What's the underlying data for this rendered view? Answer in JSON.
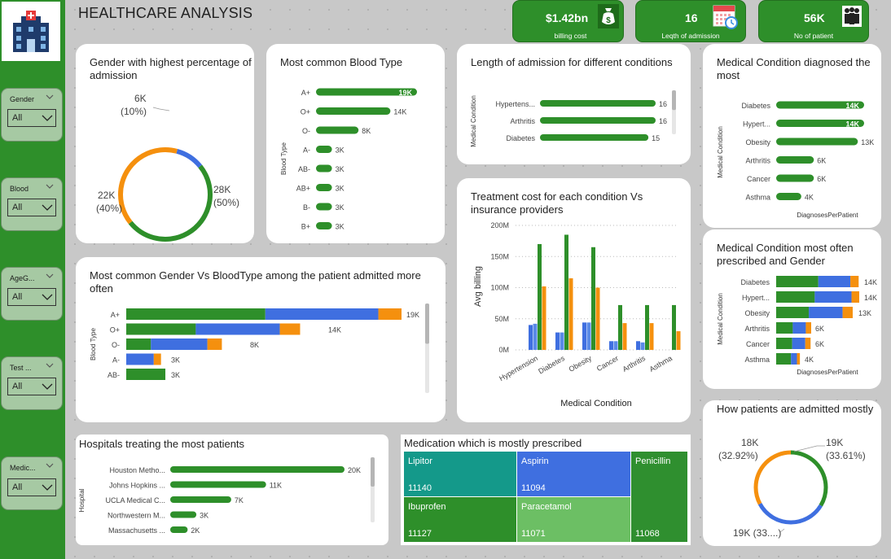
{
  "title": "HEALTHCARE ANALYSIS",
  "colors": {
    "green": "#2e8f2a",
    "blue": "#3f6fe0",
    "orange": "#f5900e",
    "light_green": "#6cbf64",
    "teal": "#1a9a88",
    "dark_green": "#2f8f2f"
  },
  "kpis": [
    {
      "value": "$1.42bn",
      "caption": "billing cost",
      "icon": "money-bag-icon"
    },
    {
      "value": "16",
      "caption": "Leqth of admission",
      "icon": "calendar-icon"
    },
    {
      "value": "56K",
      "caption": "No of patient",
      "icon": "people-icon"
    }
  ],
  "slicers": [
    {
      "label": "Gender",
      "value": "All"
    },
    {
      "label": "Blood",
      "value": "All"
    },
    {
      "label": "AgeG...",
      "value": "All"
    },
    {
      "label": "Test ...",
      "value": "All"
    },
    {
      "label": "Medic...",
      "value": "All"
    }
  ],
  "cards": {
    "gender": {
      "title": "Gender with highest percentage of admission"
    },
    "blood": {
      "title": "Most common Blood Type"
    },
    "length": {
      "title": "Length of admission for different conditions"
    },
    "diag": {
      "title": "Medical Condition diagnosed the most"
    },
    "gender_blood": {
      "title": "Most common Gender Vs BloodType among the patient admitted more often"
    },
    "treatment": {
      "title": "Treatment cost for each condition Vs insurance providers"
    },
    "presc": {
      "title": "Medical Condition most often prescribed and Gender"
    },
    "hospitals": {
      "title": "Hospitals treating the most patients"
    },
    "medication": {
      "title": "Medication which is mostly prescribed"
    },
    "admitted": {
      "title": "How patients are admitted mostly"
    }
  },
  "chart_data": [
    {
      "id": "gender_donut",
      "type": "pie",
      "slices": [
        {
          "label_top": "6K",
          "label_bottom": "(10%)",
          "value": 10,
          "color": "#3f6fe0"
        },
        {
          "label_top": "28K",
          "label_bottom": "(50%)",
          "value": 50,
          "color": "#2e8f2a"
        },
        {
          "label_top": "22K",
          "label_bottom": "(40%)",
          "value": 40,
          "color": "#f5900e"
        }
      ]
    },
    {
      "id": "blood_bar",
      "type": "bar",
      "ylabel": "Blood Type",
      "categories": [
        "A+",
        "O+",
        "O-",
        "A-",
        "AB-",
        "AB+",
        "B-",
        "B+"
      ],
      "values": [
        19,
        14,
        8,
        3,
        3,
        3,
        3,
        3
      ],
      "labels": [
        "19K",
        "14K",
        "8K",
        "3K",
        "3K",
        "3K",
        "3K",
        "3K"
      ]
    },
    {
      "id": "length_bar",
      "type": "bar",
      "ylabel": "Medical Condition",
      "categories": [
        "Hypertens...",
        "Arthritis",
        "Diabetes"
      ],
      "values": [
        16,
        16,
        15
      ],
      "labels": [
        "16",
        "16",
        "15"
      ]
    },
    {
      "id": "diag_bar",
      "type": "bar",
      "ylabel": "Medical Condition",
      "xlabel": "DiagnosesPerPatient",
      "categories": [
        "Diabetes",
        "Hypert...",
        "Obesity",
        "Arthritis",
        "Cancer",
        "Asthma"
      ],
      "values": [
        14,
        14,
        13,
        6,
        6,
        4
      ],
      "labels": [
        "14K",
        "14K",
        "13K",
        "6K",
        "6K",
        "4K"
      ]
    },
    {
      "id": "gender_blood_bar",
      "type": "bar",
      "ylabel": "Blood Type",
      "categories": [
        "A+",
        "O+",
        "O-",
        "A-",
        "AB-"
      ],
      "series": [
        {
          "values": [
            9.6,
            4.8,
            1.7,
            0,
            2.7
          ],
          "color": "#2e8f2a"
        },
        {
          "values": [
            7.8,
            5.8,
            3.9,
            1.9,
            0
          ],
          "color": "#3f6fe0"
        },
        {
          "values": [
            1.6,
            1.4,
            1.0,
            0.5,
            0
          ],
          "color": "#f5900e"
        }
      ],
      "labels": [
        "19K",
        "14K",
        "8K",
        "3K",
        "3K"
      ]
    },
    {
      "id": "treatment_bar",
      "type": "bar",
      "ylabel": "Avg billing",
      "xlabel": "Medical Condition",
      "ylim": [
        0,
        200
      ],
      "yticks": [
        "0M",
        "50M",
        "100M",
        "150M",
        "200M"
      ],
      "categories": [
        "Hypertension",
        "Diabetes",
        "Obesity",
        "Cancer",
        "Arthritis",
        "Asthma"
      ],
      "series": [
        {
          "values": [
            40,
            28,
            44,
            14,
            14,
            0
          ],
          "color": "#3f6fe0"
        },
        {
          "values": [
            42,
            28,
            44,
            14,
            12,
            0
          ],
          "color": "#5a8ae8"
        },
        {
          "values": [
            170,
            185,
            165,
            72,
            72,
            72
          ],
          "color": "#2e8f2a"
        },
        {
          "values": [
            102,
            115,
            100,
            43,
            43,
            30
          ],
          "color": "#f5900e"
        }
      ]
    },
    {
      "id": "presc_bar",
      "type": "bar",
      "ylabel": "Medical Condition",
      "xlabel": "DiagnosesPerPatient",
      "categories": [
        "Diabetes",
        "Hypert...",
        "Obesity",
        "Arthritis",
        "Cancer",
        "Asthma"
      ],
      "series": [
        {
          "values": [
            7.1,
            6.5,
            5.5,
            2.8,
            2.7,
            2.5
          ],
          "color": "#2e8f2a"
        },
        {
          "values": [
            5.4,
            6.2,
            5.7,
            2.2,
            2.2,
            1.0
          ],
          "color": "#3f6fe0"
        },
        {
          "values": [
            1.4,
            1.3,
            1.7,
            0.9,
            0.9,
            0.5
          ],
          "color": "#f5900e"
        }
      ],
      "labels": [
        "14K",
        "14K",
        "13K",
        "6K",
        "6K",
        "4K"
      ]
    },
    {
      "id": "hospital_bar",
      "type": "bar",
      "ylabel": "Hospital",
      "categories": [
        "Houston Metho...",
        "Johns Hopkins ...",
        "UCLA Medical C...",
        "Northwestern M...",
        "Massachusetts ..."
      ],
      "values": [
        20,
        11,
        7,
        3,
        2
      ],
      "labels": [
        "20K",
        "11K",
        "7K",
        "3K",
        "2K"
      ]
    },
    {
      "id": "medication_treemap",
      "type": "table",
      "items": [
        {
          "name": "Lipitor",
          "value": "11140",
          "color": "#14998a"
        },
        {
          "name": "Aspirin",
          "value": "11094",
          "color": "#3f6fe0"
        },
        {
          "name": "Penicillin",
          "value": "11068",
          "color": "#2f8f2f"
        },
        {
          "name": "Ibuprofen",
          "value": "11127",
          "color": "#2e8f2a"
        },
        {
          "name": "Paracetamol",
          "value": "11071",
          "color": "#6cbf64"
        }
      ]
    },
    {
      "id": "admission_donut",
      "type": "pie",
      "slices": [
        {
          "label_top": "19K",
          "label_bottom": "(33.61%)",
          "value": 33.61,
          "color": "#2e8f2a"
        },
        {
          "label_top": "19K (33....)",
          "label_bottom": "",
          "value": 33.47,
          "color": "#3f6fe0"
        },
        {
          "label_top": "18K",
          "label_bottom": "(32.92%)",
          "value": 32.92,
          "color": "#f5900e"
        }
      ]
    }
  ]
}
